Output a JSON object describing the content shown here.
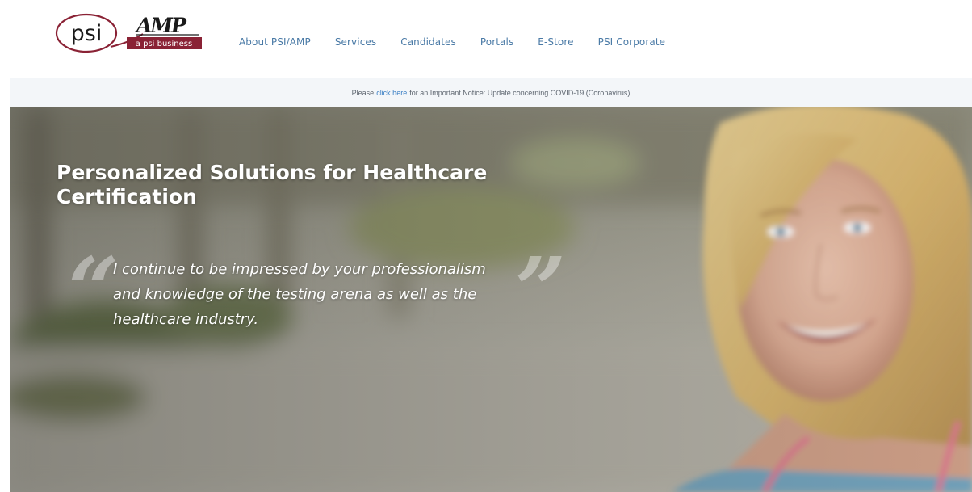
{
  "brand": {
    "logo_text": "psi",
    "logo_sub": "AMP",
    "logo_tagline": "a psi business",
    "colors": {
      "maroon": "#8a2235",
      "nav_link": "#4a7aa6",
      "notice_link": "#3b7fc4"
    }
  },
  "nav": {
    "items": [
      {
        "label": "About PSI/AMP"
      },
      {
        "label": "Services"
      },
      {
        "label": "Candidates"
      },
      {
        "label": "Portals"
      },
      {
        "label": "E-Store"
      },
      {
        "label": "PSI Corporate"
      }
    ]
  },
  "notice": {
    "prefix": "Please",
    "link": "click here",
    "suffix": "for an Important Notice: Update concerning COVID-19 (Coronavirus)"
  },
  "hero": {
    "title": "Personalized Solutions for Healthcare Certification",
    "quote_open": "“",
    "quote_close": "”",
    "quote": "I continue to be impressed by your professionalism and knowledge of the testing arena as well as the healthcare industry.",
    "image_subject": "smiling-nurse-photo"
  }
}
